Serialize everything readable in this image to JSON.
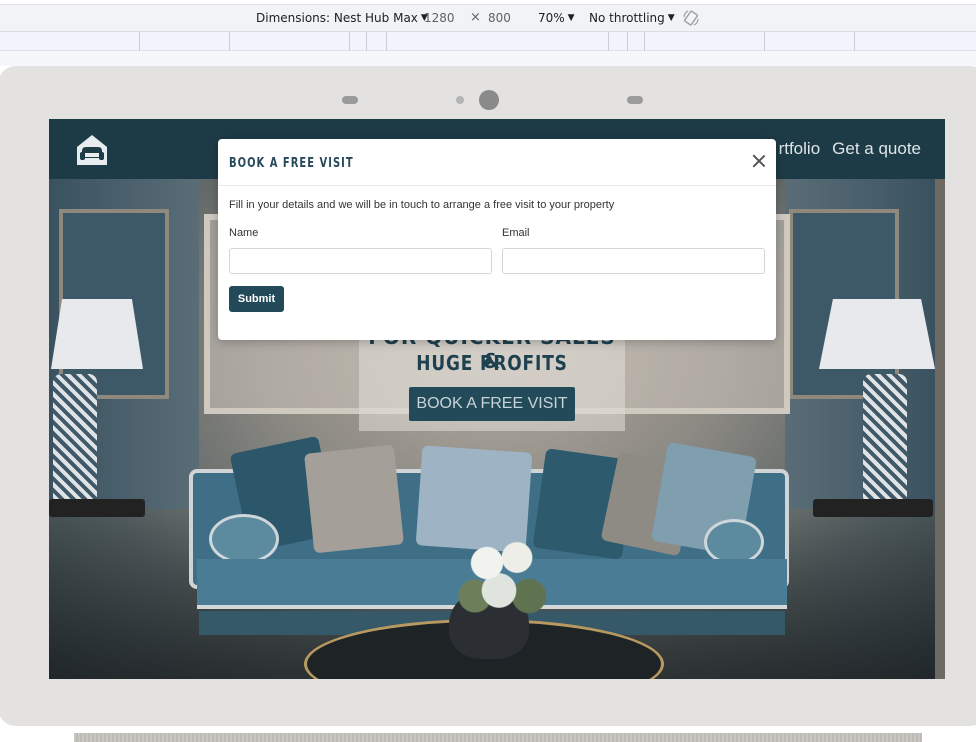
{
  "devtools": {
    "dimensions_label": "Dimensions: Nest Hub Max",
    "width": "1280",
    "times": "×",
    "height": "800",
    "zoom": "70%",
    "throttling": "No throttling",
    "caret": "▼",
    "rotate_icon": "rotate-icon"
  },
  "site": {
    "nav_links": [
      "rtfolio",
      "Get a quote"
    ],
    "hero_title_line1": "FOR QUICKER SALES &",
    "hero_title_line2": "HUGE PROFITS",
    "hero_button": "BOOK A FREE VISIT"
  },
  "modal": {
    "title": "BOOK A FREE VISIT",
    "description": "Fill in your details and we will be in touch to arrange a free visit to your property",
    "name_label": "Name",
    "name_value": "",
    "email_label": "Email",
    "email_value": "",
    "submit_label": "Submit"
  },
  "colors": {
    "brand_dark": "#1d3b46",
    "button": "#234a59",
    "modal_title": "#27495a"
  }
}
